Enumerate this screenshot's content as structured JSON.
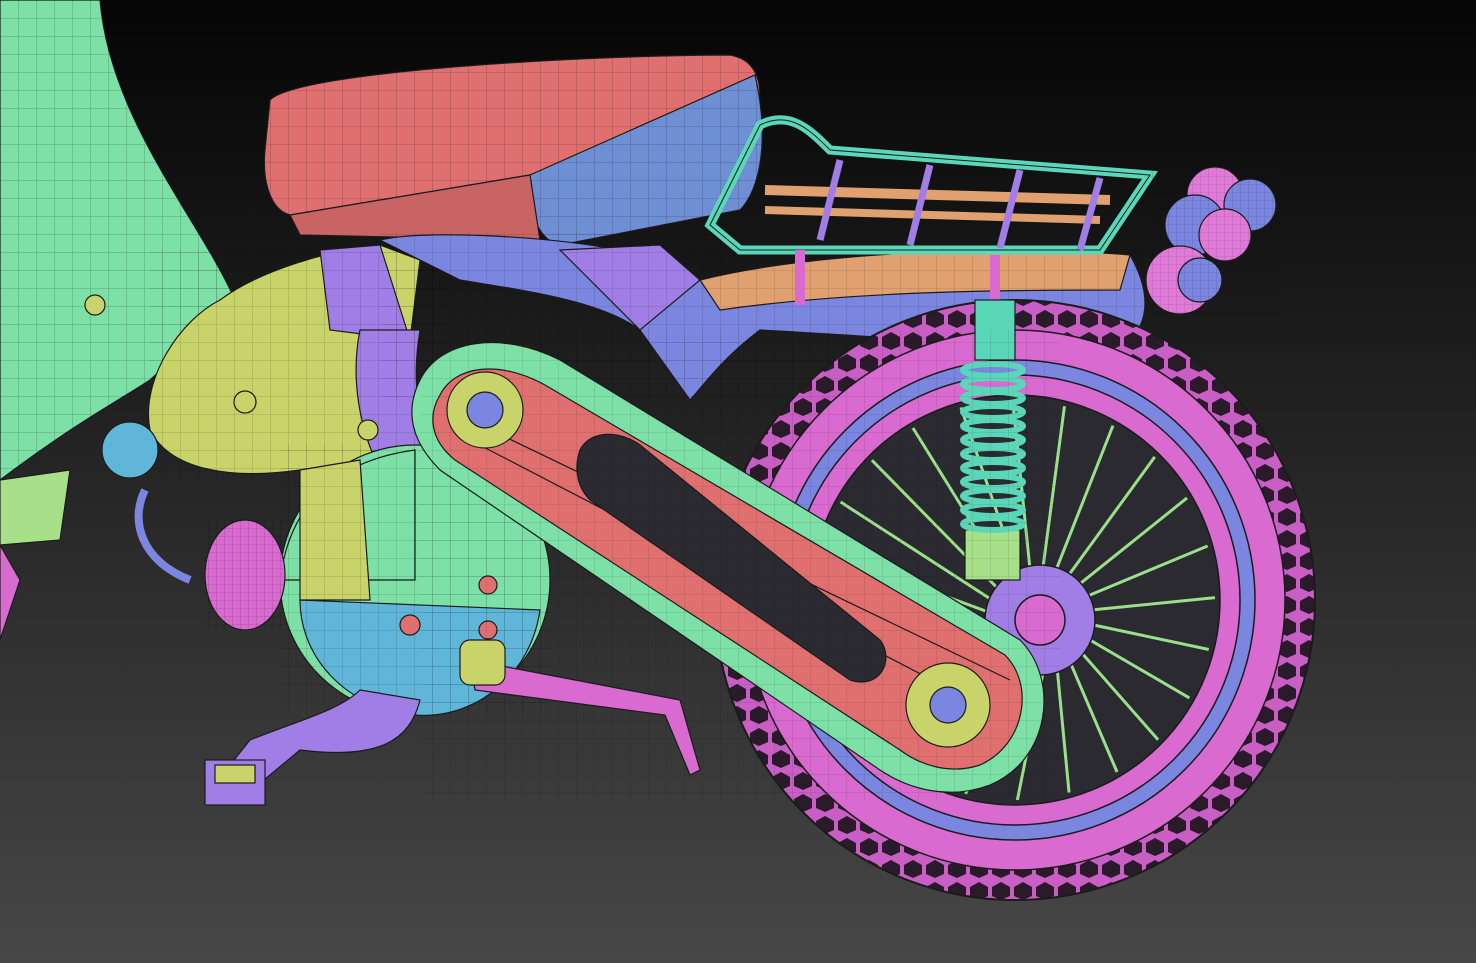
{
  "scene": {
    "subject": "motorcycle-rear-wireframe",
    "colors": {
      "seat_top": "#e07070",
      "seat_side": "#6f8fd4",
      "frame_green": "#7de0a6",
      "frame_violet": "#a07ee6",
      "frame_yellow": "#c8d46a",
      "tire_magenta": "#d86ad0",
      "rim_blue": "#7a86e0",
      "rack_teal": "#5ad6b8",
      "rack_orange": "#e0a070",
      "light_pink": "#e07ad8",
      "background_top": "#050505",
      "background_bottom": "#474747"
    }
  }
}
